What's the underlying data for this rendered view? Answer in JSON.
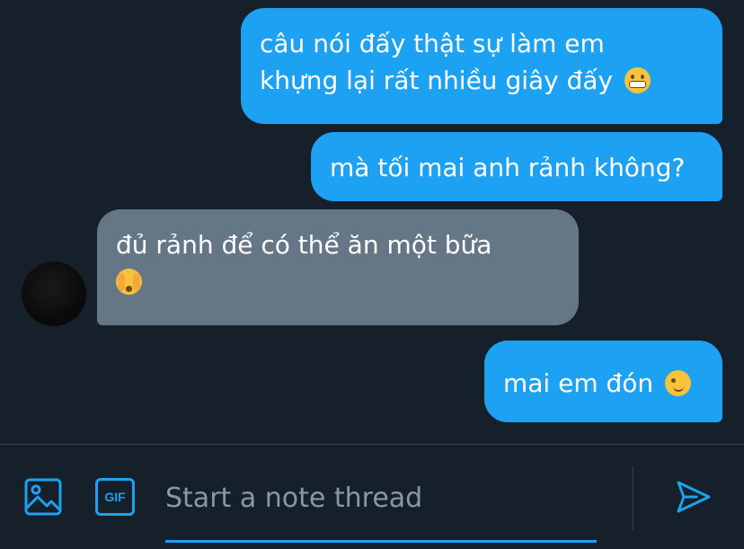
{
  "conversation": {
    "messages": [
      {
        "direction": "sent",
        "line1": "câu nói đấy thật sự làm em",
        "line2": "khựng lại rất nhiều giây đấy",
        "emoji": "grimacing-face-emoji"
      },
      {
        "direction": "sent",
        "text": "mà tối mai anh rảnh không?"
      },
      {
        "direction": "received",
        "line1": "đủ rảnh để có thể ăn một bữa",
        "emoji": "face-with-peeking-eye-emoji"
      },
      {
        "direction": "sent",
        "text": "mai em đón",
        "emoji": "winking-face-emoji"
      }
    ]
  },
  "composer": {
    "placeholder": "Start a note thread",
    "gif_label": "GIF",
    "media_icon": "image-icon",
    "send_icon": "send-icon"
  },
  "colors": {
    "background": "#15202b",
    "sent_bubble": "#1da1f2",
    "received_bubble": "#657786",
    "accent": "#1da1f2",
    "placeholder": "#8899a6",
    "divider": "#38444d"
  }
}
